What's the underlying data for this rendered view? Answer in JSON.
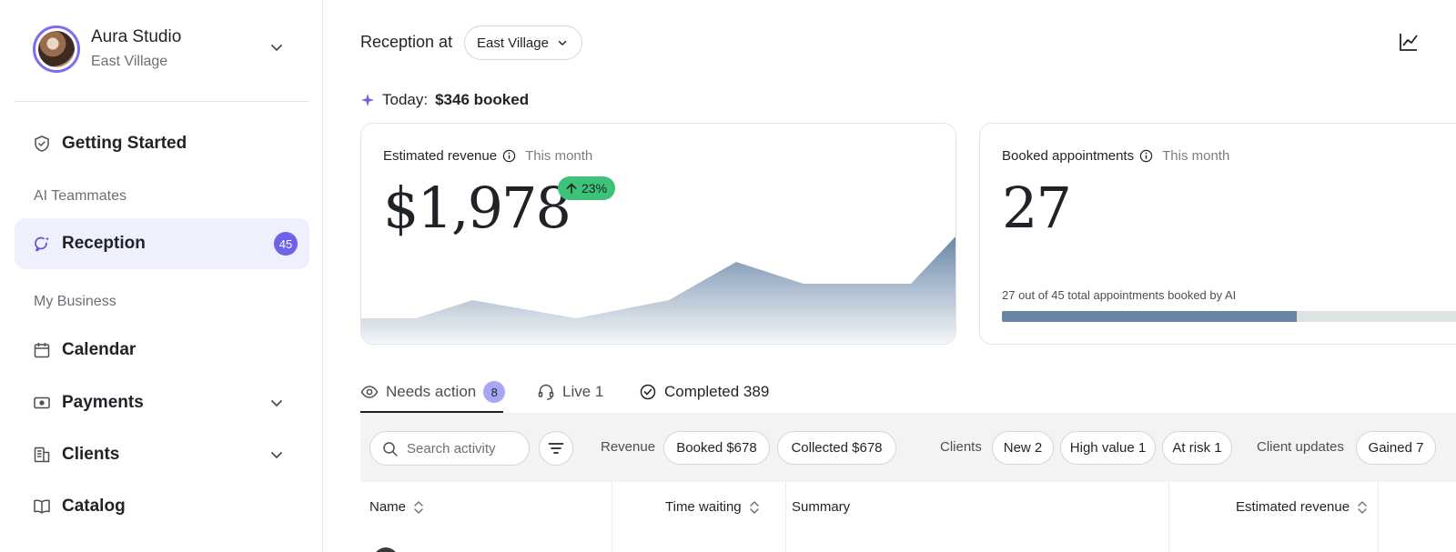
{
  "workspace": {
    "name": "Aura Studio",
    "location": "East Village"
  },
  "sidebar": {
    "getting_started": "Getting Started",
    "section_ai": "AI Teammates",
    "reception": {
      "label": "Reception",
      "badge": "45"
    },
    "section_business": "My Business",
    "items": [
      "Calendar",
      "Payments",
      "Clients",
      "Catalog"
    ]
  },
  "header": {
    "title": "Reception at",
    "location_select": "East Village"
  },
  "today": {
    "prefix": "Today:",
    "amount": "$346 booked"
  },
  "revenue_card": {
    "label": "Estimated revenue",
    "period": "This month",
    "value": "$1,978",
    "delta": "23%"
  },
  "appointments_card": {
    "label": "Booked appointments",
    "period": "This month",
    "value": "27",
    "note": "27 out of 45 total appointments booked by AI",
    "booked": 27,
    "total": 45
  },
  "tabs": {
    "needs_action": {
      "label": "Needs action",
      "count": "8"
    },
    "live": "Live 1",
    "completed": "Completed 389"
  },
  "filters": {
    "search_placeholder": "Search activity",
    "revenue_label": "Revenue",
    "booked": "Booked $678",
    "collected": "Collected $678",
    "clients_label": "Clients",
    "new": "New 2",
    "high_value": "High value 1",
    "at_risk": "At risk 1",
    "updates_label": "Client updates",
    "gained": "Gained 7"
  },
  "table": {
    "columns": [
      "Name",
      "Time waiting",
      "Summary",
      "Estimated revenue"
    ]
  },
  "colors": {
    "accent": "#6d62e8",
    "chart_fill": "#6884a6",
    "positive": "#3ec27a"
  }
}
